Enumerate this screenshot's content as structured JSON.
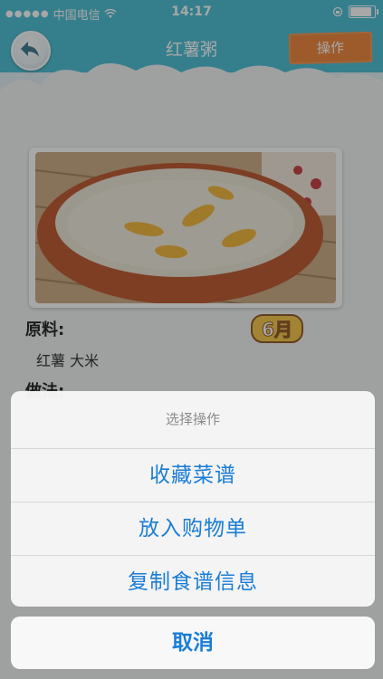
{
  "status_bar": {
    "carrier": "中国电信",
    "time": "14:17"
  },
  "header": {
    "title": "红薯粥",
    "action_label": "操作"
  },
  "recipe": {
    "ingredients_heading": "原料:",
    "ingredients": "红薯 大米",
    "month_badge": "6月",
    "method_heading": "做法:"
  },
  "action_sheet": {
    "title": "选择操作",
    "options": [
      {
        "label": "收藏菜谱"
      },
      {
        "label": "放入购物单"
      },
      {
        "label": "复制食谱信息"
      }
    ],
    "cancel_label": "取消"
  },
  "colors": {
    "header": "#3bbad2",
    "action_button": "#ee7d2a",
    "sheet_text": "#1a7dd6"
  }
}
